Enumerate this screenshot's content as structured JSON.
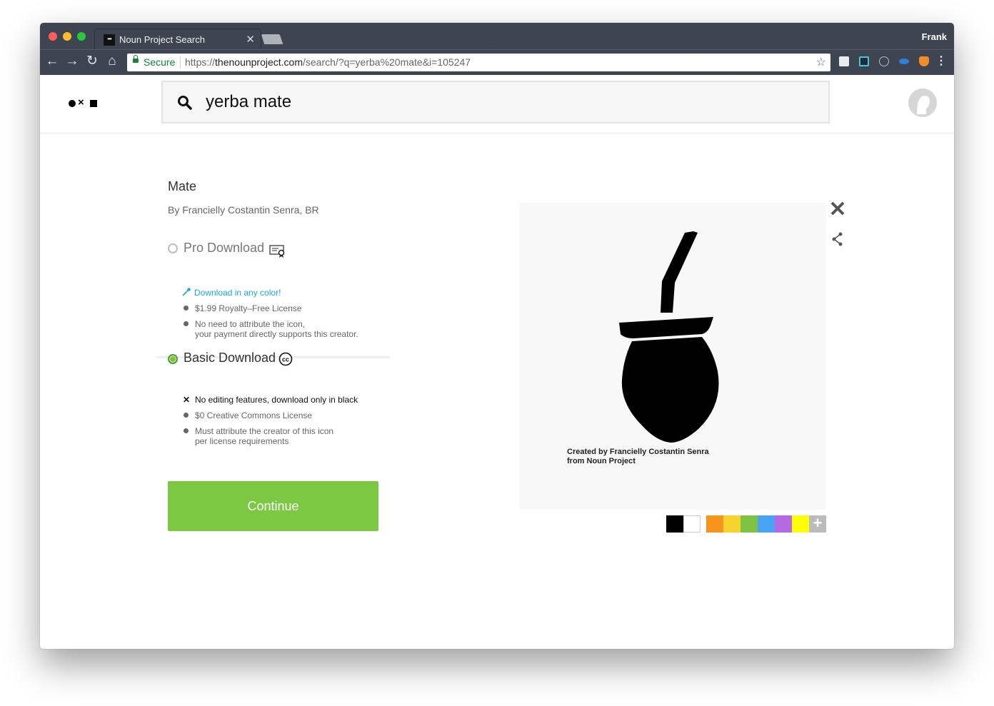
{
  "browser": {
    "tab_title": "Noun Project Search",
    "tab_favicon_text": "•••",
    "profile": "Frank",
    "secure_label": "Secure",
    "url_scheme": "https://",
    "url_host": "thenounproject.com",
    "url_path": "/search/?q=yerba%20mate&i=105247"
  },
  "search": {
    "query": "yerba mate"
  },
  "icon": {
    "title": "Mate",
    "author": "By Francielly Costantin Senra, BR",
    "credit_line1": "Created by Francielly Costantin Senra",
    "credit_line2": "from Noun Project"
  },
  "pro": {
    "label": "Pro Download",
    "color_link": "Download in any color!",
    "price": "$1.99 Royalty–Free License",
    "attr_line1": "No need to attribute the icon,",
    "attr_line2": "your payment directly supports this creator."
  },
  "basic": {
    "label": "Basic Download",
    "no_edit": "No editing features, download only in black",
    "price": "$0 Creative Commons License",
    "attr_line1": "Must attribute the creator of this icon",
    "attr_line2": "per license requirements"
  },
  "continue_label": "Continue",
  "colors": {
    "swatches": [
      "#000000",
      "#ffffff",
      "#f7941d",
      "#f6d32d",
      "#7dc242",
      "#4aa3f5",
      "#b36ae2",
      "#ffff00"
    ],
    "accent": "#7dc842",
    "link": "#1ea5e0"
  }
}
